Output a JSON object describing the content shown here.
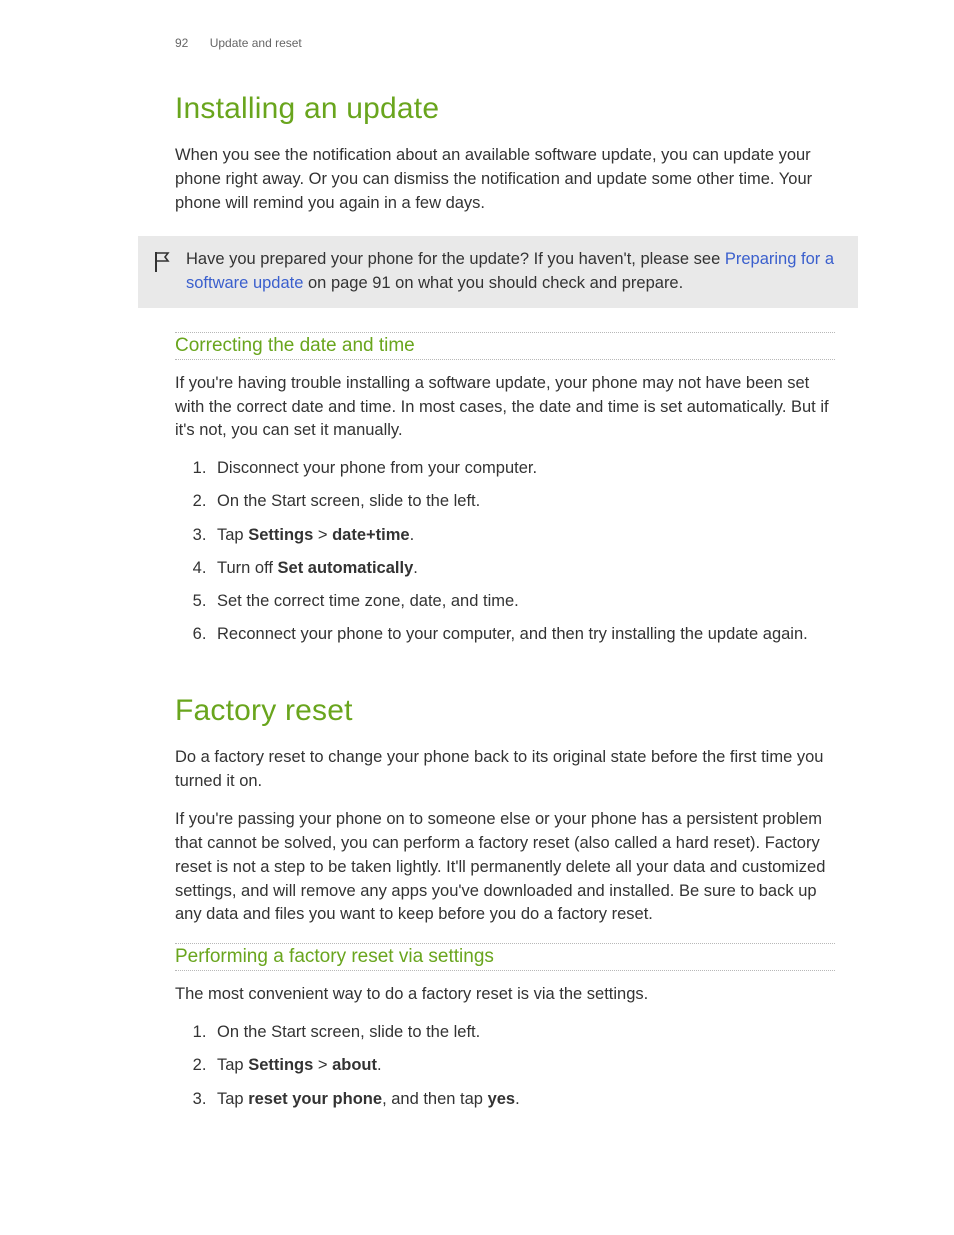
{
  "header": {
    "page_num": "92",
    "section": "Update and reset"
  },
  "section1": {
    "title": "Installing an update",
    "intro": "When you see the notification about an available software update, you can update your phone right away. Or you can dismiss the notification and update some other time. Your phone will remind you again in a few days."
  },
  "callout": {
    "text_before_link": "Have you prepared your phone for the update? If you haven't, please see ",
    "link_text": "Preparing for a software update",
    "text_after_link": " on page 91 on what you should check and prepare."
  },
  "sub1": {
    "title": "Correcting the date and time",
    "intro": "If you're having trouble installing a software update, your phone may not have been set with the correct date and time. In most cases, the date and time is set automatically. But if it's not, you can set it manually.",
    "steps": {
      "s1": "Disconnect your phone from your computer.",
      "s2": "On the Start screen, slide to the left.",
      "s3_prefix": "Tap ",
      "s3_bold1": "Settings",
      "s3_mid": " > ",
      "s3_bold2": "date+time",
      "s3_suffix": ".",
      "s4_prefix": "Turn off ",
      "s4_bold": "Set automatically",
      "s4_suffix": ".",
      "s5": "Set the correct time zone, date, and time.",
      "s6": "Reconnect your phone to your computer, and then try installing the update again."
    }
  },
  "section2": {
    "title": "Factory reset",
    "p1": "Do a factory reset to change your phone back to its original state before the first time you turned it on.",
    "p2": "If you're passing your phone on to someone else or your phone has a persistent problem that cannot be solved, you can perform a factory reset (also called a hard reset). Factory reset is not a step to be taken lightly. It'll permanently delete all your data and customized settings, and will remove any apps you've downloaded and installed. Be sure to back up any data and files you want to keep before you do a factory reset."
  },
  "sub2": {
    "title": "Performing a factory reset via settings",
    "intro": "The most convenient way to do a factory reset is via the settings.",
    "steps": {
      "s1": "On the Start screen, slide to the left.",
      "s2_prefix": "Tap ",
      "s2_bold1": "Settings",
      "s2_mid": " > ",
      "s2_bold2": "about",
      "s2_suffix": ".",
      "s3_prefix": "Tap ",
      "s3_bold1": "reset your phone",
      "s3_mid": ", and then tap ",
      "s3_bold2": "yes",
      "s3_suffix": "."
    }
  }
}
